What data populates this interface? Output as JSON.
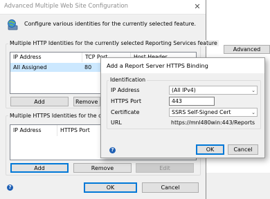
{
  "background_window": {
    "advanced_button_label": "Advanced"
  },
  "main_dialog": {
    "title": "Advanced Multiple Web Site Configuration",
    "description": "Configure various identities for the currently selected feature.",
    "http_group": {
      "label": "Multiple HTTP Identities for the currently selected Reporting Services feature",
      "columns": [
        "IP Address",
        "TCP Port",
        "Host Header"
      ],
      "rows": [
        {
          "ip": "All Assigned",
          "port": "80",
          "host": ""
        }
      ],
      "buttons": {
        "add": "Add",
        "remove": "Remove"
      }
    },
    "https_group": {
      "label": "Multiple HTTPS Identities for the currently Reporting Services feature",
      "columns": [
        "IP Address",
        "HTTPS Port"
      ],
      "buttons": {
        "add": "Add",
        "remove": "Remove",
        "edit": "Edit"
      }
    },
    "ok_label": "OK",
    "cancel_label": "Cancel"
  },
  "binding_dialog": {
    "title": "Add a Report Server HTTPS Binding",
    "group_label": "Identification",
    "ip_label": "IP Address",
    "ip_value": "(All IPv4)",
    "port_label": "HTTPS Port",
    "port_value": "443",
    "cert_label": "Certificate",
    "cert_value": "SSRS Self-Signed Cert",
    "url_label": "URL",
    "url_value": "https://mnl480win:443/Reports",
    "ok_label": "OK",
    "cancel_label": "Cancel"
  },
  "colors": {
    "selection": "#cce8ff",
    "primary_border": "#0078d7",
    "dialog_bg": "#f0f0f0"
  }
}
